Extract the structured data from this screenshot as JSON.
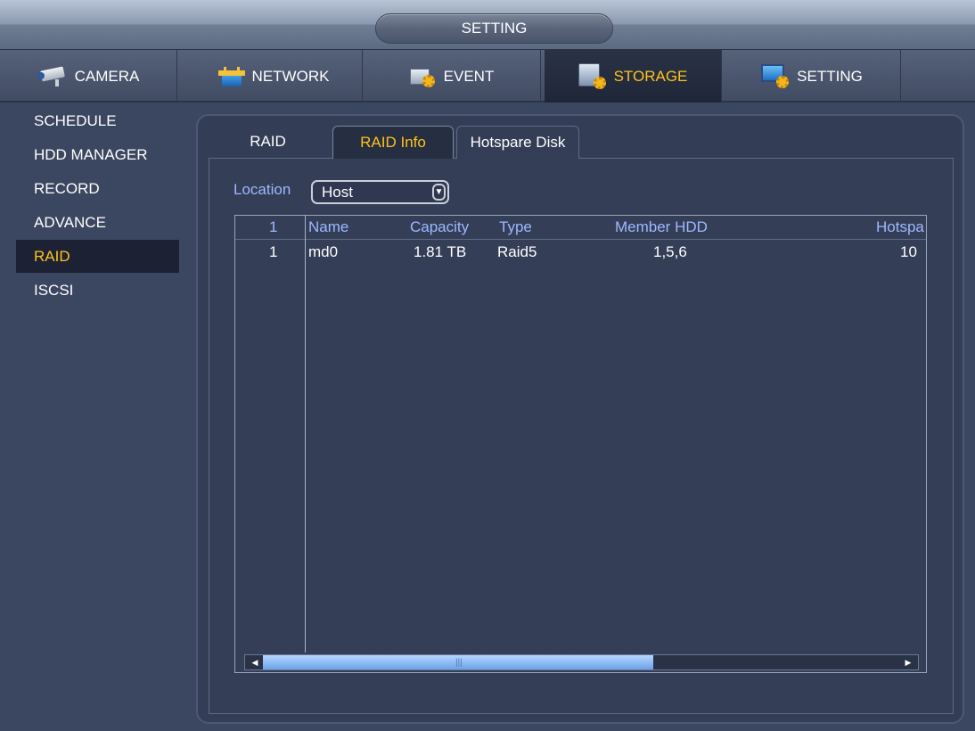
{
  "window": {
    "title": "SETTING"
  },
  "main_tabs": [
    {
      "label": "CAMERA",
      "icon": "camera-icon"
    },
    {
      "label": "NETWORK",
      "icon": "network-icon"
    },
    {
      "label": "EVENT",
      "icon": "event-icon"
    },
    {
      "label": "STORAGE",
      "icon": "storage-icon",
      "active": true
    },
    {
      "label": "SETTING",
      "icon": "setting-icon"
    }
  ],
  "sidebar": {
    "items": [
      {
        "label": "SCHEDULE"
      },
      {
        "label": "HDD MANAGER"
      },
      {
        "label": "RECORD"
      },
      {
        "label": "ADVANCE"
      },
      {
        "label": "RAID",
        "active": true
      },
      {
        "label": "ISCSI"
      }
    ]
  },
  "sub_tabs": [
    {
      "label": "RAID"
    },
    {
      "label": "RAID Info",
      "active": true
    },
    {
      "label": "Hotspare Disk"
    }
  ],
  "location": {
    "label": "Location",
    "value": "Host"
  },
  "table": {
    "headers": [
      "1",
      "Name",
      "Capacity",
      "Type",
      "Member HDD",
      "Hotspa"
    ],
    "rows": [
      [
        "1",
        "md0",
        "1.81 TB",
        "Raid5",
        "1,5,6",
        "10"
      ]
    ]
  },
  "colors": {
    "accent": "#ffc21a",
    "header_text": "#9fb8ff",
    "background": "#3b4660",
    "panel": "#333d55"
  }
}
